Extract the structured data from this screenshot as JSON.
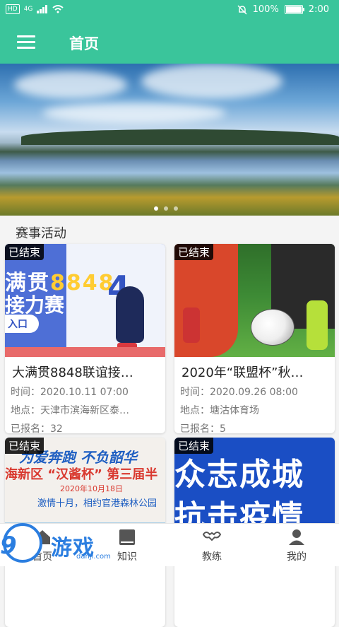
{
  "status_bar": {
    "network": "HD",
    "signal_label": "4G",
    "battery_percent": "100%",
    "battery_level": 1.0,
    "time": "2:00"
  },
  "app_bar": {
    "title": "首页",
    "menu_icon": "hamburger-menu-icon"
  },
  "banner": {
    "image": "lake-landscape",
    "slide_count": 3,
    "active_slide": 0
  },
  "section": {
    "title": "赛事活动"
  },
  "events": [
    {
      "status": "已结束",
      "name": "大满贯8848联谊接…",
      "time_label": "时间：",
      "time": "2020.10.11 07:00",
      "place_label": "地点：",
      "place": "天津市滨海新区泰…",
      "signup_label": "已报名：",
      "signup": "32",
      "poster": {
        "line1_a": "满贯",
        "line1_b": "8848",
        "line2": "接力赛",
        "button": "入口",
        "number": "4"
      }
    },
    {
      "status": "已结束",
      "name": "2020年“联盟杯”秋…",
      "time_label": "时间：",
      "time": "2020.09.26 08:00",
      "place_label": "地点：",
      "place": "塘沽体育场",
      "signup_label": "已报名：",
      "signup": "5"
    },
    {
      "status": "已结束",
      "poster": {
        "line1": "为爱奔跑 不负韶华",
        "line2": "海新区 “汉酱杯” 第三届半",
        "line3": "2020年10月18日",
        "line4": "激情十月，相约官港森林公园"
      }
    },
    {
      "status": "已结束",
      "poster": {
        "line1": "众志成城",
        "line2": "抗击疫情"
      }
    }
  ],
  "tabs": [
    {
      "label": "首页",
      "icon": "home-icon"
    },
    {
      "label": "知识",
      "icon": "book-icon"
    },
    {
      "label": "教练",
      "icon": "coach-icon"
    },
    {
      "label": "我的",
      "icon": "user-icon"
    }
  ],
  "watermark": {
    "digits": "9",
    "brand": "游戏",
    "domain": "danji.com"
  },
  "colors": {
    "primary": "#3ac59b",
    "watermark": "#2b7ee0"
  }
}
